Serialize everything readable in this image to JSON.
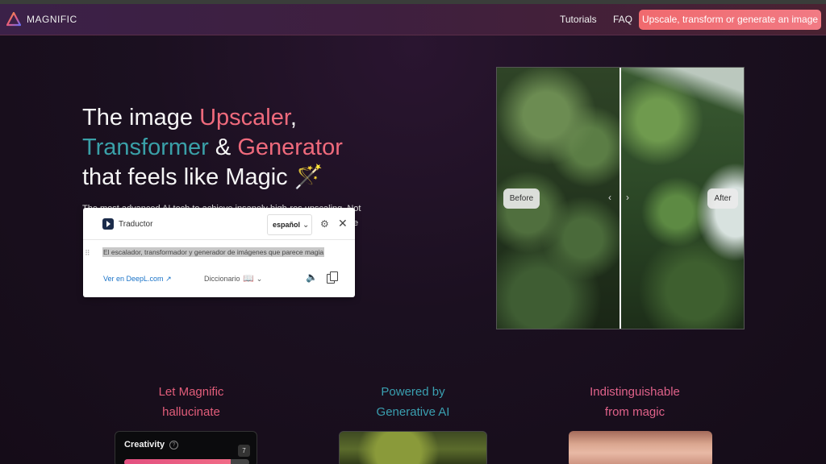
{
  "nav": {
    "brand": "MAGNIFIC",
    "links": [
      "Tutorials",
      "FAQ"
    ],
    "cta": "Upscale, transform or generate an image"
  },
  "hero": {
    "line1_a": "The image ",
    "line1_b": "Upscaler",
    "line1_c": ",",
    "line2_a": "Transformer",
    "line2_b": " & ",
    "line2_c": "Generator",
    "line3": "that feels like Magic",
    "line3_emoji": "🪄",
    "sub1": "The most advanced AI tech to achieve insanely high-res upscaling. Not",
    "sub2": "e"
  },
  "translator": {
    "title": "Traductor",
    "language": "español",
    "text": "El escalador, transformador y generador de imágenes que parece magia",
    "link": "Ver en DeepL.com",
    "dictionary": "Diccionario",
    "icons": [
      "deepl-logo-icon",
      "chevron-down-icon",
      "gear-icon",
      "close-icon",
      "drag-handle-icon",
      "external-link-icon",
      "book-icon",
      "speaker-icon",
      "copy-icon"
    ]
  },
  "compare": {
    "before_label": "Before",
    "after_label": "After"
  },
  "features": [
    {
      "line1": "Let Magnific",
      "line2": "hallucinate"
    },
    {
      "line1": "Powered by",
      "line2": "Generative AI"
    },
    {
      "line1": "Indistinguishable",
      "line2": "from magic"
    }
  ],
  "creativity_card": {
    "label": "Creativity",
    "info": "?",
    "value": "7",
    "level_fraction": 0.85
  },
  "colors": {
    "accent_pink": "#ef6a7c",
    "accent_teal": "#3aa0a8",
    "cta_bg": "#f06a6e",
    "background": "#1b1020"
  }
}
